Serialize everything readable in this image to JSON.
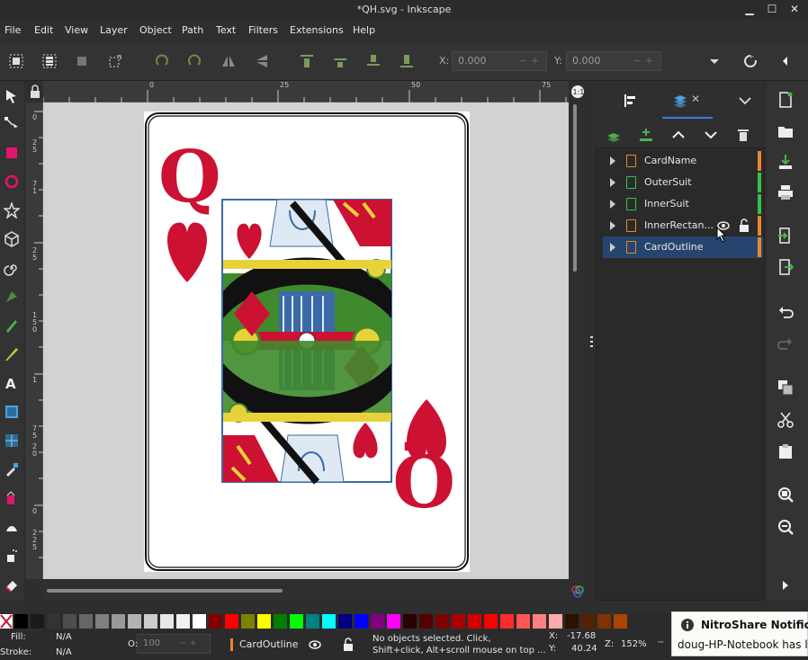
{
  "window": {
    "title": "*QH.svg - Inkscape"
  },
  "menu": [
    "File",
    "Edit",
    "View",
    "Layer",
    "Object",
    "Path",
    "Text",
    "Filters",
    "Extensions",
    "Help"
  ],
  "toolbar": {
    "x_label": "X:",
    "x_value": "0.000",
    "y_label": "Y:",
    "y_value": "0.000"
  },
  "rulers": {
    "top": [
      "0",
      "25",
      "50",
      "75"
    ],
    "left": [
      "0",
      "2",
      "5",
      "7",
      "1",
      "2",
      "5",
      "1",
      "5",
      "0",
      "1",
      "7",
      "5",
      "2",
      "0",
      "0",
      "2",
      "2",
      "5"
    ]
  },
  "layers_panel": {
    "items": [
      {
        "label": "CardName",
        "color": "#e8872d",
        "marker": "#e8872d"
      },
      {
        "label": "OuterSuit",
        "color": "#35c24a",
        "marker": "#35c24a"
      },
      {
        "label": "InnerSuit",
        "color": "#35c24a",
        "marker": "#35c24a"
      },
      {
        "label": "InnerRectan...",
        "color": "#e8872d",
        "marker": "#e8872d"
      },
      {
        "label": "CardOutline",
        "color": "#e8872d",
        "marker": "#e8872d",
        "selected": true
      }
    ]
  },
  "card": {
    "rank_top": "Q",
    "rank_bottom": "Q"
  },
  "status": {
    "fill_label": "Fill:",
    "fill_value": "N/A",
    "stroke_label": "Stroke:",
    "stroke_value": "N/A",
    "opacity_label": "O:",
    "opacity_value": "100",
    "layer": "CardOutline",
    "message_line1": "No objects selected. Click,",
    "message_line2": "Shift+click, Alt+scroll mouse on top ...",
    "x_label": "X:",
    "x_value": "-17.68",
    "y_label": "Y:",
    "y_value": "40.24",
    "zoom_label": "Z:",
    "zoom_value": "152%"
  },
  "notification": {
    "title": "NitroShare Notificat",
    "body": "doug-HP-Notebook has le"
  }
}
